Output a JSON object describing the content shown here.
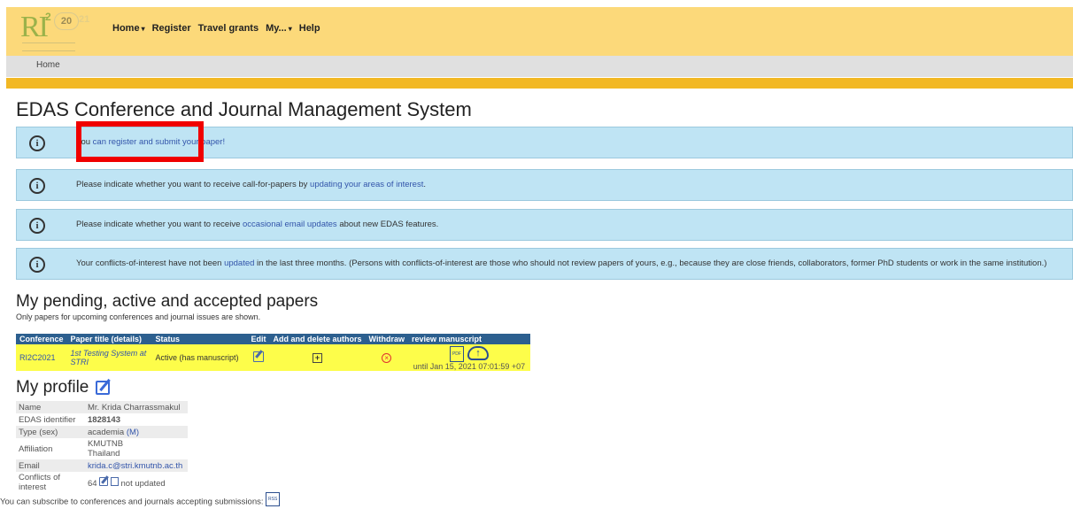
{
  "header": {
    "logo": {
      "text_ri": "RI",
      "text_sup": "2",
      "text_year": "20",
      "text_year2": "21"
    },
    "nav": [
      {
        "label": "Home",
        "has_caret": true
      },
      {
        "label": "Register",
        "has_caret": false
      },
      {
        "label": "Travel grants",
        "has_caret": false
      },
      {
        "label": "My...",
        "has_caret": true
      },
      {
        "label": "Help",
        "has_caret": false
      }
    ],
    "caret": "▾",
    "breadcrumb": "Home"
  },
  "page_title": "EDAS Conference and Journal Management System",
  "alerts": [
    {
      "before": "You ",
      "link": "can register and submit your paper!",
      "after": ""
    },
    {
      "before": "Please indicate whether you want to receive call-for-papers by ",
      "link": "updating your areas of interest",
      "after": "."
    },
    {
      "before": "Please indicate whether you want to receive ",
      "link": "occasional email updates",
      "after": " about new EDAS features."
    },
    {
      "before": "Your conflicts-of-interest have not been ",
      "link": "updated",
      "after": " in the last three months. (Persons with conflicts-of-interest are those who should not review papers of yours, e.g., because they are close friends, collaborators, former PhD students or work in the same institution.)"
    }
  ],
  "alert_icon": "i",
  "papers": {
    "title": "My pending, active and accepted papers",
    "note": "Only papers for upcoming conferences and journal issues are shown.",
    "columns": [
      "Conference",
      "Paper title (details)",
      "Status",
      "Edit",
      "Add and delete authors",
      "Withdraw",
      "review manuscript"
    ],
    "rows": [
      {
        "conference": "RI2C2021",
        "title": "1st Testing System at STRI",
        "status": "Active (has manuscript)",
        "until": "until Jan 15, 2021 07:01:59 +07"
      }
    ],
    "icons": {
      "plus": "+",
      "x": "×",
      "pdf": "PDF",
      "cloud": "↑"
    }
  },
  "profile": {
    "title": "My profile",
    "rows": [
      {
        "key": "Name",
        "value": "Mr. Krida Charrassmakul",
        "lines": []
      },
      {
        "key": "EDAS identifier",
        "value": "1828143",
        "lines": []
      },
      {
        "key": "Type (sex)",
        "value": "academia",
        "extra": "(M)",
        "lines": []
      },
      {
        "key": "Affiliation",
        "value": "KMUTNB",
        "value2": "Thailand"
      },
      {
        "key": "Email",
        "value": "krida.c@stri.kmutnb.ac.th"
      },
      {
        "key": "Conflicts of interest",
        "value": "64",
        "extra": "not updated"
      }
    ]
  },
  "subscribe_text": "You can subscribe to conferences and journals accepting submissions:",
  "rss_icon": "RSS"
}
